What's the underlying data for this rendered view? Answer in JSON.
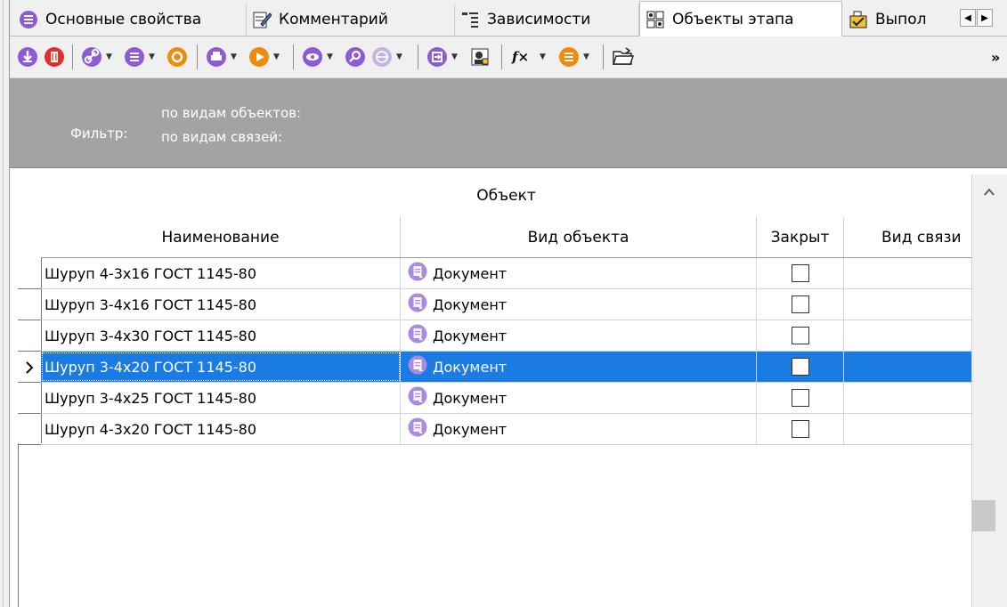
{
  "tabs": [
    {
      "label": "Основные свойства",
      "icon": "purple-list-icon"
    },
    {
      "label": "Комментарий",
      "icon": "edit-note-icon"
    },
    {
      "label": "Зависимости",
      "icon": "dependencies-icon"
    },
    {
      "label": "Объекты этапа",
      "icon": "stage-objects-icon",
      "active": true
    },
    {
      "label": "Выпол",
      "icon": "execution-icon"
    }
  ],
  "tab_scroll": {
    "left": "◀",
    "right": "▶"
  },
  "toolbar": {
    "overflow": "»",
    "fx_label": "f×"
  },
  "filter": {
    "label": "Фильтр:",
    "by_object_types": "по видам объектов:",
    "by_link_types": "по видам связей:"
  },
  "grid": {
    "group_header": "Объект",
    "columns": [
      "Наименование",
      "Вид объекта",
      "Закрыт",
      "Вид связи"
    ],
    "rows": [
      {
        "name": "Шуруп 4-3x16 ГОСТ 1145-80",
        "kind": "Документ",
        "closed": false,
        "link": ""
      },
      {
        "name": "Шуруп 3-4x16 ГОСТ 1145-80",
        "kind": "Документ",
        "closed": false,
        "link": ""
      },
      {
        "name": "Шуруп 3-4x30 ГОСТ 1145-80",
        "kind": "Документ",
        "closed": false,
        "link": ""
      },
      {
        "name": "Шуруп 3-4x20 ГОСТ 1145-80",
        "kind": "Документ",
        "closed": false,
        "link": "",
        "selected": true
      },
      {
        "name": "Шуруп 3-4x25 ГОСТ 1145-80",
        "kind": "Документ",
        "closed": false,
        "link": ""
      },
      {
        "name": "Шуруп 4-3x20 ГОСТ 1145-80",
        "kind": "Документ",
        "closed": false,
        "link": ""
      }
    ],
    "current_row_marker": "›"
  },
  "colors": {
    "selection": "#1a7ce3",
    "purple": "#8e5bd6",
    "red": "#e0302a",
    "orange": "#f08a0a"
  }
}
